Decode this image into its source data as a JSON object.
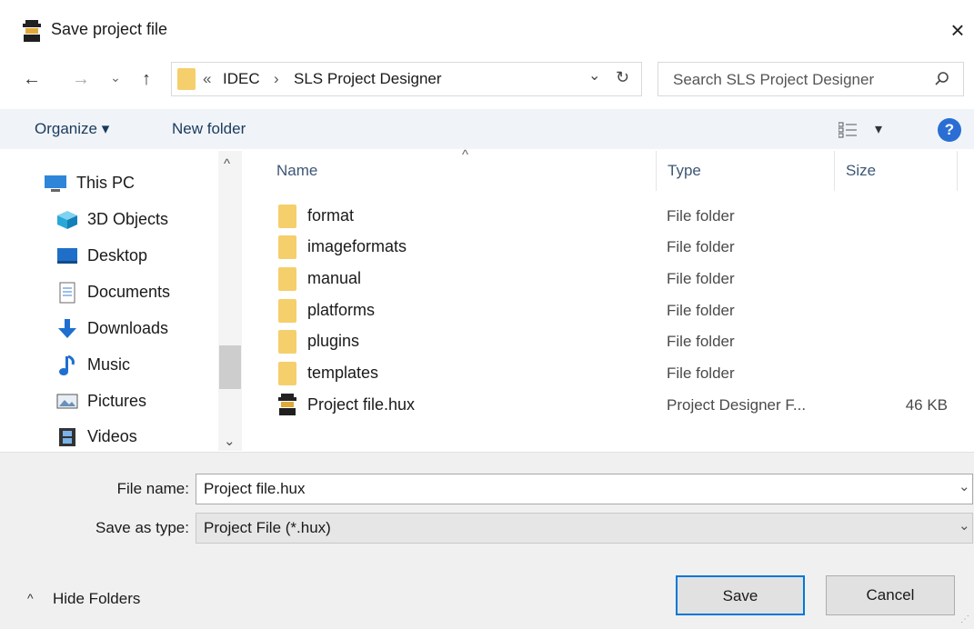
{
  "window": {
    "title": "Save project file",
    "close_glyph": "×"
  },
  "nav": {
    "back_glyph": "←",
    "forward_glyph": "→",
    "recent_glyph": "⌄",
    "up_glyph": "↑",
    "path_prefix": "«",
    "breadcrumb": [
      "IDEC",
      "SLS Project Designer"
    ],
    "separator": "›",
    "dropdown_glyph": "⌄",
    "refresh_glyph": "↻"
  },
  "search": {
    "placeholder": "Search SLS Project Designer",
    "icon": "search-icon"
  },
  "toolbar": {
    "organize": "Organize ▾",
    "new_folder": "New folder",
    "view_glyph": "▾",
    "help_glyph": "?"
  },
  "sidebar": {
    "items": [
      {
        "label": "This PC",
        "icon": "computer-icon"
      },
      {
        "label": "3D Objects",
        "icon": "cube-icon"
      },
      {
        "label": "Desktop",
        "icon": "desktop-icon"
      },
      {
        "label": "Documents",
        "icon": "documents-icon"
      },
      {
        "label": "Downloads",
        "icon": "download-icon"
      },
      {
        "label": "Music",
        "icon": "music-icon"
      },
      {
        "label": "Pictures",
        "icon": "pictures-icon"
      },
      {
        "label": "Videos",
        "icon": "videos-icon"
      }
    ],
    "scroll_up_glyph": "^",
    "scroll_down_glyph": "⌄"
  },
  "file_list": {
    "columns": {
      "name": "Name",
      "type": "Type",
      "size": "Size",
      "sort_glyph": "^"
    },
    "rows": [
      {
        "name": "format",
        "type": "File folder",
        "size": "",
        "icon": "folder-icon"
      },
      {
        "name": "imageformats",
        "type": "File folder",
        "size": "",
        "icon": "folder-icon"
      },
      {
        "name": "manual",
        "type": "File folder",
        "size": "",
        "icon": "folder-icon"
      },
      {
        "name": "platforms",
        "type": "File folder",
        "size": "",
        "icon": "folder-icon"
      },
      {
        "name": "plugins",
        "type": "File folder",
        "size": "",
        "icon": "folder-icon"
      },
      {
        "name": "templates",
        "type": "File folder",
        "size": "",
        "icon": "folder-icon"
      },
      {
        "name": "Project file.hux",
        "type": "Project Designer F...",
        "size": "46 KB",
        "icon": "project-file-icon"
      }
    ]
  },
  "form": {
    "file_name_label": "File name:",
    "file_name_value": "Project file.hux",
    "save_type_label": "Save as type:",
    "save_type_value": "Project File (*.hux)",
    "dropdown_glyph": "⌄"
  },
  "footer": {
    "hide_folders": "Hide Folders",
    "hide_glyph": "^",
    "save": "Save",
    "cancel": "Cancel"
  }
}
